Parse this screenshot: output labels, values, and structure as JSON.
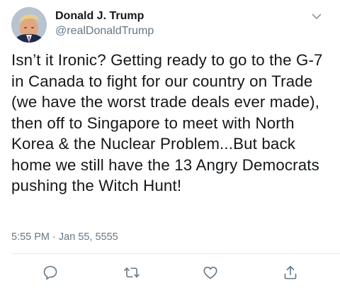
{
  "user": {
    "display_name": "Donald J. Trump",
    "handle": "@realDonaldTrump",
    "avatar_icon": "profile-photo"
  },
  "tweet": {
    "text": "Isn’t it Ironic? Getting ready to go to the G-7 in Canada to fight for our country on Trade (we have the worst trade deals ever made), then off to Singapore to meet with North Korea & the Nuclear Problem...But back home we still have the 13 Angry Democrats pushing the Witch Hunt!",
    "timestamp": "5:55 PM · Jan 55, 5555"
  },
  "actions": [
    {
      "name": "reply",
      "icon": "speech-bubble-icon"
    },
    {
      "name": "retweet",
      "icon": "retweet-arrows-icon"
    },
    {
      "name": "like",
      "icon": "heart-icon"
    },
    {
      "name": "share",
      "icon": "share-upload-icon"
    }
  ],
  "colors": {
    "text": "#14171a",
    "secondary": "#657786",
    "divider": "#e1e8ed"
  }
}
